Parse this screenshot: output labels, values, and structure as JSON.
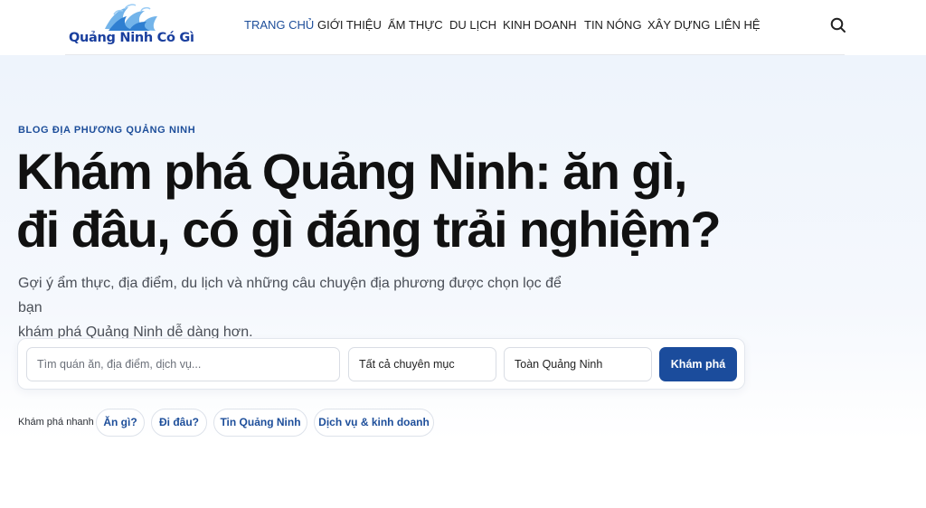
{
  "header": {
    "logo_text": "Quảng Ninh Có Gì",
    "nav": [
      {
        "label": "TRANG CHỦ",
        "active": true
      },
      {
        "label": "GIỚI THIỆU",
        "active": false
      },
      {
        "label": "ẨM THỰC",
        "active": false
      },
      {
        "label": "DU LỊCH",
        "active": false
      },
      {
        "label": "KINH DOANH",
        "active": false
      },
      {
        "label": "TIN NÓNG",
        "active": false
      },
      {
        "label": "XÂY DỰNG",
        "active": false
      },
      {
        "label": "LIÊN HỆ",
        "active": false
      }
    ],
    "search_icon": "search-icon"
  },
  "hero": {
    "kicker": "BLOG ĐỊA PHƯƠNG QUẢNG NINH",
    "headline_line1": "Khám phá Quảng Ninh: ăn gì,",
    "headline_line2": "đi đâu, có gì đáng trải nghiệm?",
    "lead_line1": "Gợi ý ẩm thực, địa điểm, du lịch và những câu chuyện địa phương được chọn lọc để bạn",
    "lead_line2": "khám phá Quảng Ninh dễ dàng hơn."
  },
  "search": {
    "query_placeholder": "Tìm quán ăn, địa điểm, dịch vụ...",
    "category_value": "Tất cả chuyên mục",
    "area_value": "Toàn Quảng Ninh",
    "submit_label": "Khám phá"
  },
  "quick": {
    "label": "Khám phá nhanh",
    "chips": [
      "Ăn gì?",
      "Đi đâu?",
      "Tin Quảng Ninh",
      "Dịch vụ & kinh doanh"
    ]
  },
  "colors": {
    "brand": "#1b4c9c",
    "accent_text": "#1d4e9a",
    "hero_bg": "#eef4fc"
  }
}
